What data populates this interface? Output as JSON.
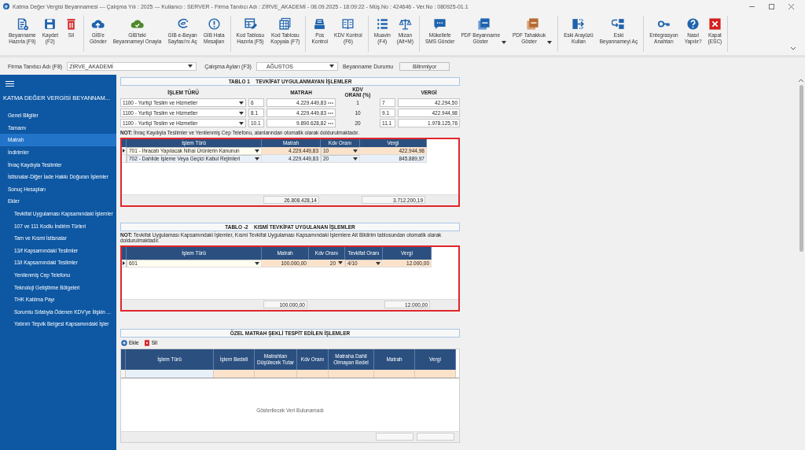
{
  "window": {
    "title": "Katma Değer Vergisi Beyannamesi  ---  Çalışma Yılı : 2025  ---  Kullanıcı : SERVER - Firma Tanıtıcı Adı : ZİRVE_AKADEMİ - 08.09.2025 - 18:09:22 - Müş.No : 424646 - Ver.No : 080925-01.1"
  },
  "toolbar": {
    "groups": [
      {
        "items": [
          {
            "label": "Beyanname\nHazırla (F9)",
            "kind": "document"
          },
          {
            "label": "Kaydet\n(F2)",
            "kind": "save"
          },
          {
            "label": "Sil",
            "kind": "trash"
          }
        ]
      },
      {
        "items": [
          {
            "label": "GİB'e\nGönder",
            "kind": "cloud-up"
          },
          {
            "label": "GİB'teki\nBeyannameyi Onayla",
            "kind": "cloud-check"
          },
          {
            "label": "GİB e-Beyan\nSayfası'nı Aç",
            "kind": "swirl"
          },
          {
            "label": "GİB Hata\nMesajları",
            "kind": "alert"
          }
        ]
      },
      {
        "items": [
          {
            "label": "Kod Tablosu\nHazırla (F5)",
            "kind": "table-pen"
          },
          {
            "label": "Kod Tablosu\nKopyala (F7)",
            "kind": "table"
          }
        ]
      },
      {
        "items": [
          {
            "label": "Pos\nKontrol",
            "kind": "register"
          },
          {
            "label": "KDV Kontrol\n(F6)",
            "kind": "book"
          }
        ]
      },
      {
        "items": [
          {
            "label": "Muavin\n(F4)",
            "kind": "list"
          },
          {
            "label": "Mizan\n(Alt+M)",
            "kind": "scale"
          }
        ]
      },
      {
        "items": [
          {
            "label": "Mükellefe\nSMS Gönder",
            "kind": "chat"
          },
          {
            "label": "PDF Beyanname\nGöster",
            "kind": "pdf-blue",
            "dropdown": true
          },
          {
            "label": "PDF Tahakkuk\nGöster",
            "kind": "pdf-brown",
            "dropdown": true
          }
        ]
      },
      {
        "items": [
          {
            "label": "Eski Arayüzü\nKullan",
            "kind": "swap"
          },
          {
            "label": "Eski\nBeyannameyi Aç",
            "kind": "reopen"
          }
        ]
      },
      {
        "items": [
          {
            "label": "Entegrasyon\nAnahtarı",
            "kind": "key"
          },
          {
            "label": "Nasıl\nYapılır?",
            "kind": "help"
          },
          {
            "label": "Kapat\n(ESC)",
            "kind": "close"
          }
        ]
      }
    ]
  },
  "filters": {
    "company_label": "Firma Tanıtıcı Adı (F8)",
    "company": "ZİRVE_AKADEMİ",
    "month_label": "Çalışma Ayları (F3)",
    "month": "AĞUSTOS",
    "status_label": "Beyanname Durumu",
    "status": "Bilinmiyor"
  },
  "sidebar": {
    "title": "KATMA  DEĞER VERGİSİ BEYANNAM...",
    "items": [
      {
        "label": "Genel Bilgiler",
        "selected": false
      },
      {
        "label": "Tamamı",
        "selected": false
      },
      {
        "label": "Matrah",
        "selected": true
      },
      {
        "label": "İndirimler",
        "selected": false
      },
      {
        "label": "İhraç Kaydıyla Teslimler",
        "selected": false
      },
      {
        "label": "İstisnalar-Diğer İade Hakkı Doğuran İşlemler",
        "selected": false
      },
      {
        "label": "Sonuç Hesapları",
        "selected": false
      },
      {
        "label": "Ekler",
        "selected": false,
        "children": [
          {
            "label": "Tevkifat Uygulaması Kapsamındaki İşlemler",
            "selected": false
          },
          {
            "label": "107 ve 111 Kodlu İndirim Türleri",
            "selected": false
          },
          {
            "label": "Tam ve Kısmi İstisnalar",
            "selected": false
          },
          {
            "label": "13/f Kapsamındaki Teslimler",
            "selected": false
          },
          {
            "label": "13/i Kapsamındaki Teslimler",
            "selected": false
          },
          {
            "label": "Yenilenmiş Cep Telefonu",
            "selected": false
          },
          {
            "label": "Teknoloji Geliştirme Bölgeleri",
            "selected": false
          },
          {
            "label": "THK Katılma Payı",
            "selected": false
          },
          {
            "label": "Sorumlu Sıfatıyla Ödenen KDV'ye İlişkin ...",
            "selected": false
          },
          {
            "label": "Yatırım Teşvik Belgesi Kapsamındaki İşler",
            "selected": false
          }
        ]
      }
    ]
  },
  "table1": {
    "title": "TABLO 1    TEVKİFAT UYGULANMAYAN İŞLEMLER",
    "columns": [
      "İŞLEM TÜRÜ",
      "MATRAH",
      "KDV ORANI (%)",
      "VERGİ"
    ],
    "rows": [
      {
        "type": "1100 - Yurtiçi Teslim ve Hizmetler",
        "code": "6",
        "matrah": "4.229.449,83",
        "rate": "1",
        "rate_code": "7",
        "vergi": "42.294,50"
      },
      {
        "type": "1100 - Yurtiçi Teslim ve Hizmetler",
        "code": "8.1",
        "matrah": "4.229.449,83",
        "rate": "10",
        "rate_code": "9.1",
        "vergi": "422.944,98"
      },
      {
        "type": "1100 - Yurtiçi Teslim ve Hizmetler",
        "code": "10.1",
        "matrah": "9.890.628,82",
        "rate": "20",
        "rate_code": "11.1",
        "vergi": "1.978.125,76"
      }
    ],
    "note": "**NOT:** İhraç Kaydıyla Teslimler ve Yenilenmiş Cep Telefonu, alanlarından otomatik olarak doldurulmaktadır.",
    "grid": {
      "highlighted": true,
      "columns": [
        {
          "label": "İşlem Türü",
          "kind": "combo"
        },
        {
          "label": "Matrah",
          "kind": "number"
        },
        {
          "label": "Kdv Oranı",
          "kind": "combo"
        },
        {
          "label": "Vergi",
          "kind": "number"
        }
      ],
      "rows": [
        {
          "selected": true,
          "cells": [
            "701 - İhracatı Yapılacak Nihai Ürünlerin Kanunun",
            "4.229.449,83",
            "10",
            "422.944,98"
          ]
        },
        {
          "selected": false,
          "cells": [
            "702 - Dahilde İşleme Veya Geçici Kabul Rejimleri",
            "4.229.449,83",
            "20",
            "845.889,97"
          ]
        }
      ],
      "totals": {
        "matrah": "26.808.428,14",
        "vergi": "3.712.200,19"
      }
    }
  },
  "table2": {
    "title": "TABLO -2    KISMİ TEVKİFAT UYGULANAN İŞLEMLER",
    "note": "**NOT:** Tevkifat Uygulaması Kapsamındaki İşlemler, Kısmi Tevkifat Uygulaması Kapsamındaki İşlemlere Ait Bildirim tablosundan otomatik olarak doldurulmaktadır.",
    "grid": {
      "highlighted": true,
      "columns": [
        {
          "label": "İşlem Türü",
          "kind": "combo"
        },
        {
          "label": "Matrah",
          "kind": "number"
        },
        {
          "label": "Kdv Oranı",
          "kind": "number-combo"
        },
        {
          "label": "Tevkifat Oranı",
          "kind": "combo"
        },
        {
          "label": "Vergi",
          "kind": "number"
        }
      ],
      "rows": [
        {
          "selected": true,
          "cells": [
            "601",
            "100.000,00",
            "20",
            "4/10",
            "12.000,00"
          ]
        }
      ],
      "totals": {
        "matrah": "100.000,00",
        "vergi": "12.000,00"
      }
    }
  },
  "table3": {
    "title": "ÖZEL MATRAH ŞEKLİ TESPİT EDİLEN İŞLEMLER",
    "actions": [
      {
        "label": "Ekle",
        "kind": "add"
      },
      {
        "label": "Sil",
        "kind": "delete"
      }
    ],
    "grid": {
      "highlighted": false,
      "new_row": true,
      "columns": [
        {
          "label": "İşlem Türü"
        },
        {
          "label": "İşlem Bedeli"
        },
        {
          "label": "Matrahtan Düşülecek Tutar"
        },
        {
          "label": "Kdv Oranı"
        },
        {
          "label": "Matraha Dahil Olmayan Bedel"
        },
        {
          "label": "Matrah"
        },
        {
          "label": "Vergi"
        }
      ],
      "empty_message": "Gösterilecek Veri Bulunamadı"
    }
  }
}
